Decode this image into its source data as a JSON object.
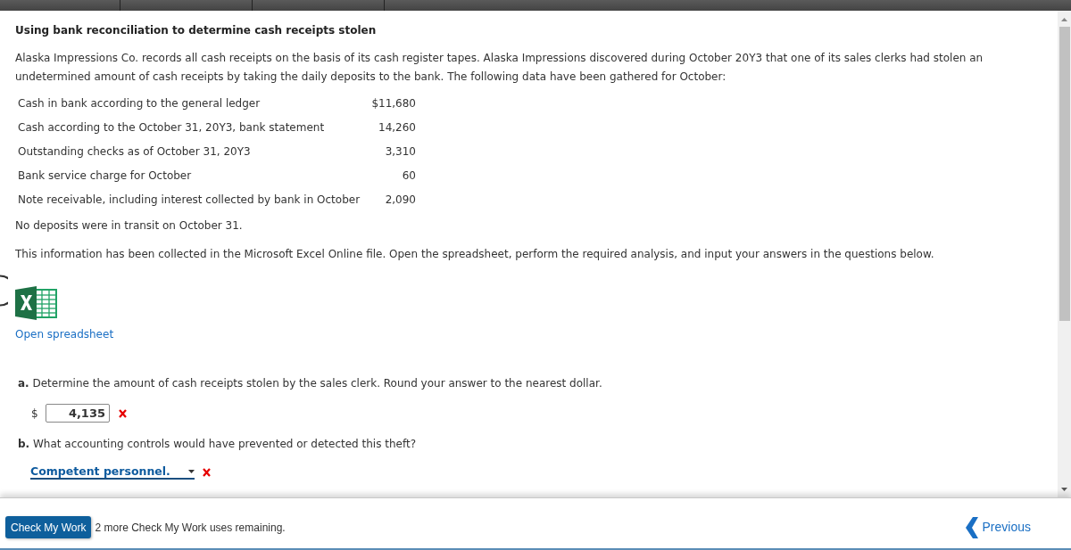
{
  "title": "Using bank reconciliation to determine cash receipts stolen",
  "intro": "Alaska Impressions Co. records all cash receipts on the basis of its cash register tapes. Alaska Impressions discovered during October 20Y3 that one of its sales clerks had stolen an undetermined amount of cash receipts by taking the daily deposits to the bank. The following data have been gathered for October:",
  "data_table": {
    "rows": [
      {
        "label": "Cash in bank according to the general ledger",
        "amount": "$11,680"
      },
      {
        "label": "Cash according to the October 31, 20Y3, bank statement",
        "amount": "14,260"
      },
      {
        "label": "Outstanding checks as of October 31, 20Y3",
        "amount": "3,310"
      },
      {
        "label": "Bank service charge for October",
        "amount": "60"
      },
      {
        "label": "Note receivable, including interest collected by bank in October",
        "amount": "2,090"
      }
    ]
  },
  "note": "No deposits were in transit on October 31.",
  "instructions": "This information has been collected in the Microsoft Excel Online file. Open the spreadsheet, perform the required analysis, and input your answers in the questions below.",
  "spreadsheet_link": {
    "label": "Open spreadsheet"
  },
  "questions": [
    {
      "kind": "numeric",
      "prompt": "**a.** Determine the amount of cash receipts stolen by the sales clerk. Round your answer to the nearest dollar.",
      "prefix": "$",
      "value": "4,135",
      "correct": false
    },
    {
      "kind": "dropdown",
      "prompt": "**b.** What accounting controls would have prevented or detected this theft?",
      "value": "Competent personnel.",
      "correct": false
    }
  ],
  "footer": {
    "check_button": "Check My Work",
    "remaining": "2 more Check My Work uses remaining.",
    "previous_button": "Previous"
  }
}
